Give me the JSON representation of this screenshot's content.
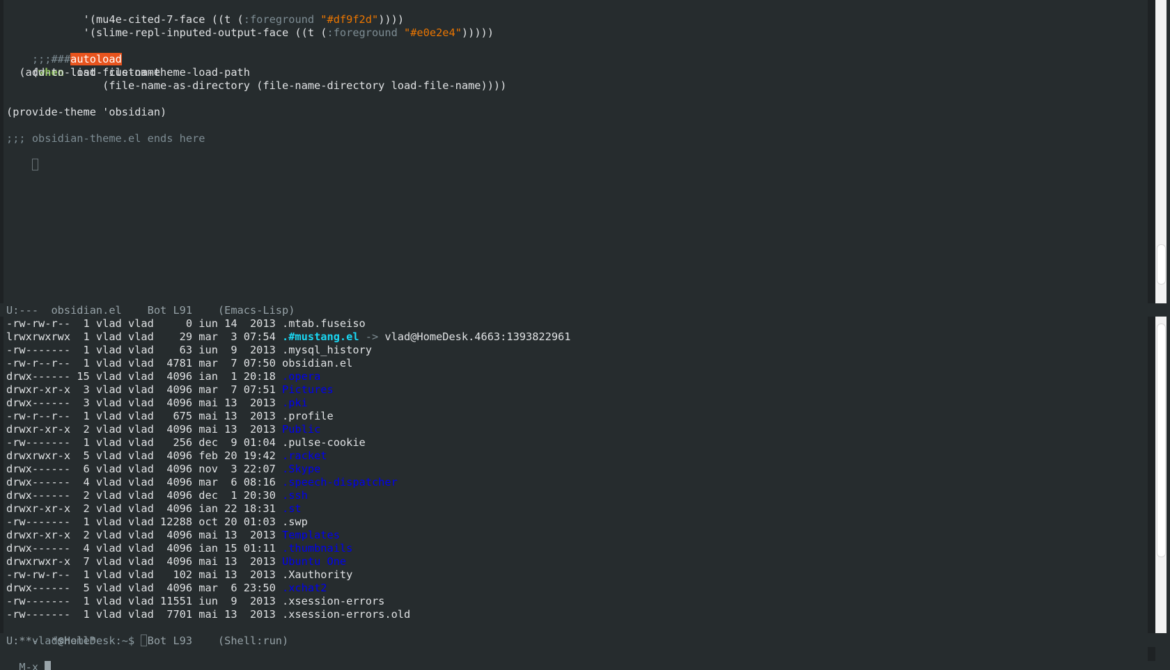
{
  "top_pane": {
    "code_lines": [
      {
        "pre": "        '(mu4e-cited-7-face ((t (",
        "kw": ":foreground",
        "mid": " ",
        "str": "\"#df9f2d\"",
        "post": "))))"
      },
      {
        "pre": "        '(slime-repl-inputed-output-face ((t (",
        "kw": ":foreground",
        "mid": " ",
        "str": "\"#e0e2e4\"",
        "post": ")))))"
      }
    ],
    "autoload_prefix": ";;;###",
    "autoload_word": "autoload",
    "when_open": "(",
    "when_kw": "when",
    "when_rest": " load-file-name",
    "add_to_list": "  (add-to-list 'custom-theme-load-path",
    "file_name": "               (file-name-as-directory (file-name-directory load-file-name))))",
    "provide": "(provide-theme 'obsidian)",
    "ends_comment": ";;; obsidian-theme.el ends here",
    "mode_line": "U:---  obsidian.el    Bot L91    (Emacs-Lisp)"
  },
  "shell_pane": {
    "files": [
      {
        "meta": "-rw-rw-r--  1 vlad vlad     0 iun 14  2013 ",
        "name": ".mtab.fuseiso",
        "type": "file"
      },
      {
        "meta": "lrwxrwxrwx  1 vlad vlad    29 mar  3 07:54 ",
        "name": ".#mustang.el",
        "type": "link",
        "arrow": " -> ",
        "target": "vlad@HomeDesk.4663:1393822961"
      },
      {
        "meta": "-rw-------  1 vlad vlad    63 iun  9  2013 ",
        "name": ".mysql_history",
        "type": "file"
      },
      {
        "meta": "-rw-r--r--  1 vlad vlad  4781 mar  7 07:50 ",
        "name": "obsidian.el",
        "type": "file"
      },
      {
        "meta": "drwx------ 15 vlad vlad  4096 ian  1 20:18 ",
        "name": ".opera",
        "type": "dir"
      },
      {
        "meta": "drwxr-xr-x  3 vlad vlad  4096 mar  7 07:51 ",
        "name": "Pictures",
        "type": "dir"
      },
      {
        "meta": "drwx------  3 vlad vlad  4096 mai 13  2013 ",
        "name": ".pki",
        "type": "dir"
      },
      {
        "meta": "-rw-r--r--  1 vlad vlad   675 mai 13  2013 ",
        "name": ".profile",
        "type": "file"
      },
      {
        "meta": "drwxr-xr-x  2 vlad vlad  4096 mai 13  2013 ",
        "name": "Public",
        "type": "dir"
      },
      {
        "meta": "-rw-------  1 vlad vlad   256 dec  9 01:04 ",
        "name": ".pulse-cookie",
        "type": "file"
      },
      {
        "meta": "drwxrwxr-x  5 vlad vlad  4096 feb 20 19:42 ",
        "name": ".racket",
        "type": "dir"
      },
      {
        "meta": "drwx------  6 vlad vlad  4096 nov  3 22:07 ",
        "name": ".Skype",
        "type": "dir"
      },
      {
        "meta": "drwx------  4 vlad vlad  4096 mar  6 08:16 ",
        "name": ".speech-dispatcher",
        "type": "dir"
      },
      {
        "meta": "drwx------  2 vlad vlad  4096 dec  1 20:30 ",
        "name": ".ssh",
        "type": "dir"
      },
      {
        "meta": "drwxr-xr-x  2 vlad vlad  4096 ian 22 18:31 ",
        "name": ".st",
        "type": "dir"
      },
      {
        "meta": "-rw-------  1 vlad vlad 12288 oct 20 01:03 ",
        "name": ".swp",
        "type": "file"
      },
      {
        "meta": "drwxr-xr-x  2 vlad vlad  4096 mai 13  2013 ",
        "name": "Templates",
        "type": "dir"
      },
      {
        "meta": "drwx------  4 vlad vlad  4096 ian 15 01:11 ",
        "name": ".thumbnails",
        "type": "dir"
      },
      {
        "meta": "drwxrwxr-x  7 vlad vlad  4096 mai 13  2013 ",
        "name": "Ubuntu One",
        "type": "dir"
      },
      {
        "meta": "-rw-rw-r--  1 vlad vlad   102 mai 13  2013 ",
        "name": ".Xauthority",
        "type": "file"
      },
      {
        "meta": "drwx------  5 vlad vlad  4096 mar  6 23:50 ",
        "name": ".xchat2",
        "type": "dir"
      },
      {
        "meta": "-rw-------  1 vlad vlad 11551 iun  9  2013 ",
        "name": ".xsession-errors",
        "type": "file"
      },
      {
        "meta": "-rw-------  1 vlad vlad  7701 mai 13  2013 ",
        "name": ".xsession-errors.old",
        "type": "file"
      }
    ],
    "prompt": "vlad@HomeDesk:~$ ",
    "mode_line": "U:**-  *shell*        Bot L93    (Shell:run)"
  },
  "minibuffer": {
    "prompt": "M-x "
  }
}
